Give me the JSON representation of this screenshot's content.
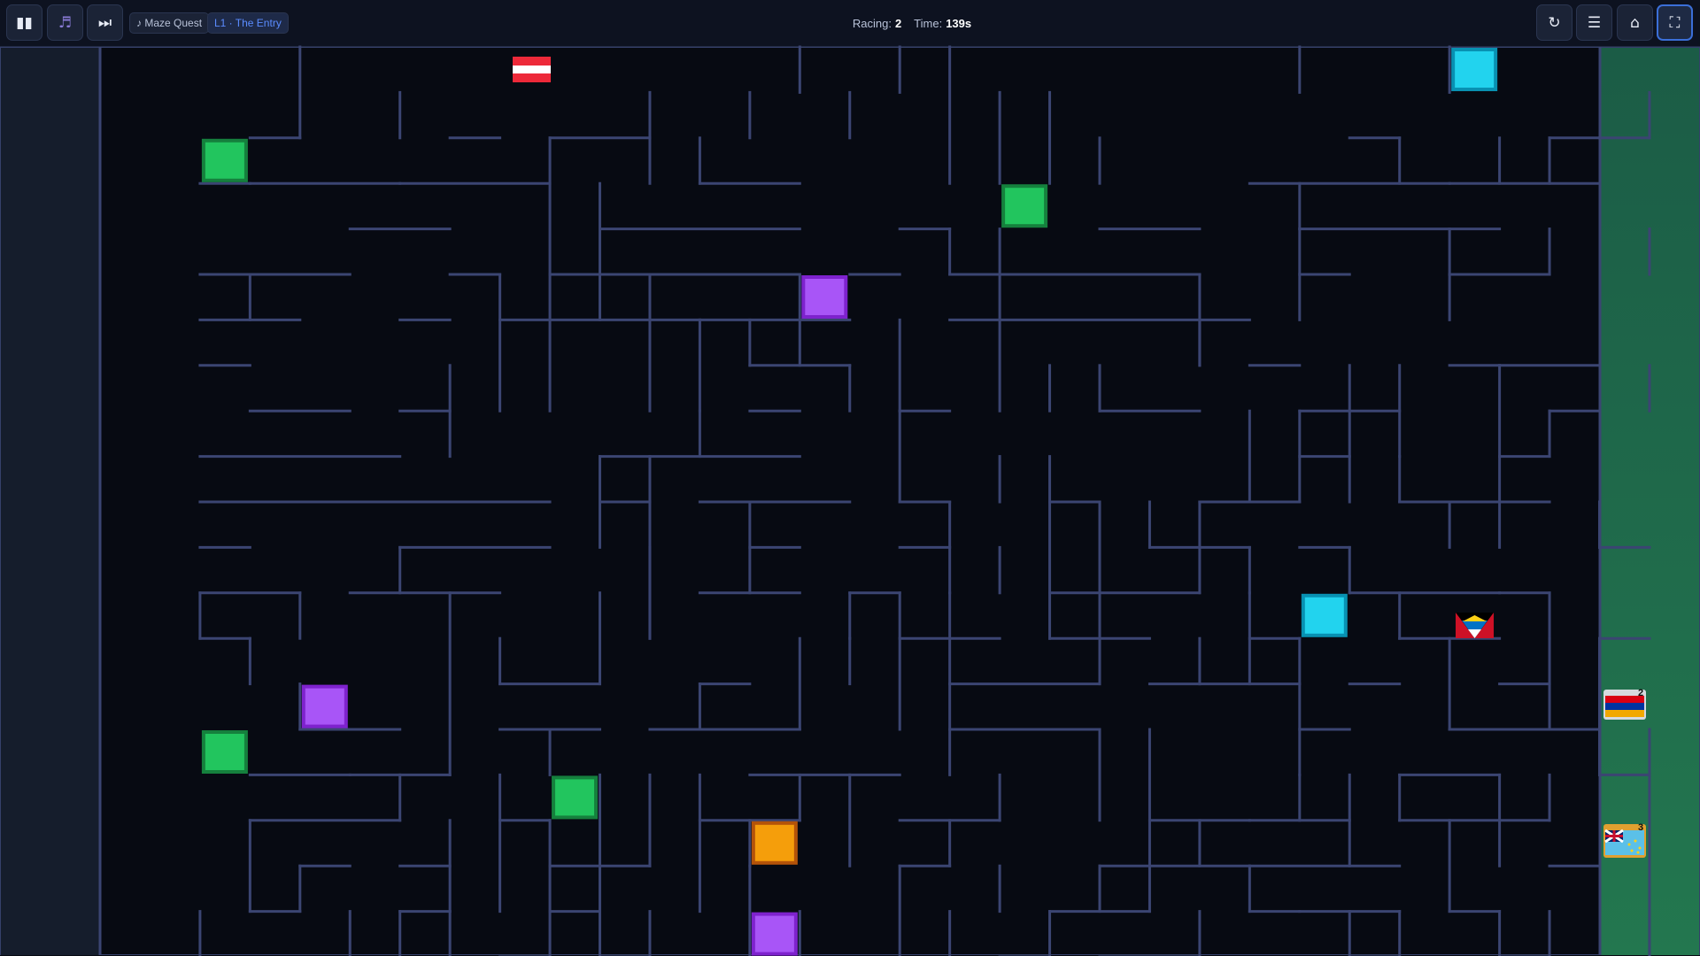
{
  "toolbar": {
    "pause_icon": "pause-icon",
    "music_icon": "music-note-icon",
    "skip_icon": "skip-forward-icon",
    "song_label": "♪ Maze Quest",
    "level_label": "L1 · The Entry",
    "restart_icon": "restart-icon",
    "menu_icon": "menu-icon",
    "home_icon": "home-icon",
    "fullscreen_icon": "fullscreen-icon"
  },
  "status": {
    "racing_label": "Racing:",
    "racing_value": "2",
    "time_label": "Time:",
    "time_value": "139s"
  },
  "finishers": [
    {
      "rank": "2",
      "flag": "armenia-flag"
    },
    {
      "rank": "3",
      "flag": "tuvalu-flag"
    }
  ],
  "racers": [
    {
      "name": "austria-flag"
    },
    {
      "name": "antigua-and-barbuda-flag"
    }
  ],
  "colors": {
    "wall": "#3b4572",
    "background": "#070a12",
    "start_zone": "#151d2c",
    "goal_zone": "#1f6b4c",
    "green_block": "#22c55e",
    "purple_block": "#a855f7",
    "cyan_block": "#22d3ee",
    "orange_block": "#f59e0b",
    "accent": "#3b6fd8"
  },
  "blocks": [
    {
      "color": "cyan",
      "cell": [
        27,
        0
      ]
    },
    {
      "color": "green",
      "cell": [
        2,
        2
      ]
    },
    {
      "color": "green",
      "cell": [
        18,
        3
      ]
    },
    {
      "color": "purple",
      "cell": [
        14,
        5
      ]
    },
    {
      "color": "cyan",
      "cell": [
        24,
        12
      ]
    },
    {
      "color": "purple",
      "cell": [
        4,
        14
      ]
    },
    {
      "color": "green",
      "cell": [
        2,
        15
      ]
    },
    {
      "color": "green",
      "cell": [
        9,
        16
      ]
    },
    {
      "color": "orange",
      "cell": [
        13,
        17
      ]
    },
    {
      "color": "purple",
      "cell": [
        13,
        19
      ]
    }
  ],
  "maze_walls": {
    "h": [
      [
        4,
        2,
        3
      ],
      [
        7,
        2,
        8
      ],
      [
        9,
        2,
        11
      ],
      [
        25,
        2,
        26
      ],
      [
        29,
        2,
        30
      ],
      [
        30,
        2,
        31
      ],
      [
        2,
        3,
        3
      ],
      [
        3,
        3,
        6
      ],
      [
        6,
        3,
        9
      ],
      [
        12,
        3,
        14
      ],
      [
        23,
        3,
        27
      ],
      [
        27,
        3,
        30
      ],
      [
        5,
        4,
        7
      ],
      [
        10,
        4,
        14
      ],
      [
        16,
        4,
        17
      ],
      [
        20,
        4,
        22
      ],
      [
        24,
        4,
        28
      ],
      [
        2,
        5,
        5
      ],
      [
        7,
        5,
        8
      ],
      [
        9,
        5,
        10
      ],
      [
        10,
        5,
        14
      ],
      [
        15,
        5,
        16
      ],
      [
        17,
        5,
        22
      ],
      [
        24,
        5,
        25
      ],
      [
        27,
        5,
        29
      ],
      [
        2,
        6,
        4
      ],
      [
        6,
        6,
        7
      ],
      [
        8,
        6,
        12
      ],
      [
        12,
        6,
        15
      ],
      [
        17,
        6,
        23
      ],
      [
        2,
        7,
        3
      ],
      [
        13,
        7,
        15
      ],
      [
        23,
        7,
        24
      ],
      [
        27,
        7,
        28
      ],
      [
        28,
        7,
        30
      ],
      [
        3,
        8,
        5
      ],
      [
        6,
        8,
        7
      ],
      [
        13,
        8,
        14
      ],
      [
        16,
        8,
        17
      ],
      [
        20,
        8,
        22
      ],
      [
        24,
        8,
        26
      ],
      [
        29,
        8,
        30
      ],
      [
        2,
        9,
        6
      ],
      [
        10,
        9,
        14
      ],
      [
        24,
        9,
        25
      ],
      [
        28,
        9,
        29
      ],
      [
        2,
        10,
        9
      ],
      [
        10,
        10,
        11
      ],
      [
        12,
        10,
        15
      ],
      [
        16,
        10,
        17
      ],
      [
        19,
        10,
        20
      ],
      [
        22,
        10,
        24
      ],
      [
        26,
        10,
        28
      ],
      [
        28,
        10,
        29
      ],
      [
        2,
        11,
        3
      ],
      [
        6,
        11,
        9
      ],
      [
        13,
        11,
        14
      ],
      [
        16,
        11,
        17
      ],
      [
        21,
        11,
        23
      ],
      [
        24,
        11,
        25
      ],
      [
        30,
        11,
        31
      ],
      [
        2,
        12,
        4
      ],
      [
        5,
        12,
        8
      ],
      [
        12,
        12,
        14
      ],
      [
        15,
        12,
        16
      ],
      [
        19,
        12,
        22
      ],
      [
        25,
        12,
        28
      ],
      [
        28,
        12,
        29
      ],
      [
        2,
        13,
        3
      ],
      [
        16,
        13,
        18
      ],
      [
        19,
        13,
        21
      ],
      [
        23,
        13,
        24
      ],
      [
        26,
        13,
        28
      ],
      [
        30,
        13,
        31
      ],
      [
        8,
        14,
        10
      ],
      [
        12,
        14,
        13
      ],
      [
        17,
        14,
        20
      ],
      [
        21,
        14,
        22
      ],
      [
        22,
        14,
        24
      ],
      [
        25,
        14,
        26
      ],
      [
        28,
        14,
        29
      ],
      [
        4,
        15,
        6
      ],
      [
        8,
        15,
        10
      ],
      [
        11,
        15,
        13
      ],
      [
        13,
        15,
        14
      ],
      [
        17,
        15,
        20
      ],
      [
        24,
        15,
        25
      ],
      [
        27,
        15,
        30
      ],
      [
        3,
        16,
        5
      ],
      [
        5,
        16,
        6
      ],
      [
        6,
        16,
        7
      ],
      [
        13,
        16,
        15
      ],
      [
        15,
        16,
        16
      ],
      [
        26,
        16,
        28
      ],
      [
        30,
        16,
        31
      ],
      [
        3,
        17,
        6
      ],
      [
        8,
        17,
        9
      ],
      [
        12,
        17,
        14
      ],
      [
        16,
        17,
        18
      ],
      [
        21,
        17,
        23
      ],
      [
        23,
        17,
        25
      ],
      [
        26,
        17,
        29
      ],
      [
        4,
        18,
        5
      ],
      [
        6,
        18,
        7
      ],
      [
        9,
        18,
        11
      ],
      [
        16,
        18,
        17
      ],
      [
        20,
        18,
        23
      ],
      [
        23,
        18,
        26
      ],
      [
        29,
        18,
        30
      ],
      [
        3,
        19,
        4
      ],
      [
        6,
        19,
        7
      ],
      [
        9,
        19,
        10
      ],
      [
        19,
        19,
        21
      ],
      [
        23,
        19,
        24
      ],
      [
        24,
        19,
        26
      ],
      [
        27,
        19,
        28
      ],
      [
        8,
        20,
        9
      ],
      [
        10,
        20,
        11
      ],
      [
        18,
        20,
        19
      ],
      [
        20,
        20,
        22
      ],
      [
        25,
        20,
        26
      ],
      [
        28,
        20,
        29
      ]
    ],
    "v": [
      [
        4,
        0,
        2
      ],
      [
        14,
        0,
        1
      ],
      [
        16,
        0,
        1
      ],
      [
        17,
        0,
        3
      ],
      [
        24,
        0,
        1
      ],
      [
        27,
        0,
        1
      ],
      [
        6,
        1,
        2
      ],
      [
        11,
        1,
        3
      ],
      [
        13,
        1,
        2
      ],
      [
        15,
        1,
        2
      ],
      [
        12,
        2,
        3
      ],
      [
        18,
        1,
        3
      ],
      [
        19,
        1,
        3
      ],
      [
        20,
        2,
        3
      ],
      [
        9,
        2,
        6
      ],
      [
        10,
        3,
        5
      ],
      [
        24,
        3,
        4
      ],
      [
        26,
        2,
        3
      ],
      [
        28,
        2,
        3
      ],
      [
        29,
        2,
        3
      ],
      [
        31,
        1,
        2
      ],
      [
        17,
        4,
        5
      ],
      [
        18,
        4,
        6
      ],
      [
        24,
        4,
        6
      ],
      [
        27,
        4,
        6
      ],
      [
        29,
        4,
        5
      ],
      [
        31,
        4,
        5
      ],
      [
        3,
        5,
        6
      ],
      [
        8,
        5,
        8
      ],
      [
        10,
        5,
        6
      ],
      [
        11,
        5,
        8
      ],
      [
        14,
        5,
        7
      ],
      [
        16,
        6,
        8
      ],
      [
        12,
        6,
        8
      ],
      [
        22,
        5,
        7
      ],
      [
        22,
        6,
        7
      ],
      [
        7,
        7,
        9
      ],
      [
        9,
        6,
        8
      ],
      [
        13,
        6,
        7
      ],
      [
        15,
        7,
        8
      ],
      [
        18,
        6,
        8
      ],
      [
        19,
        7,
        8
      ],
      [
        20,
        7,
        8
      ],
      [
        25,
        7,
        10
      ],
      [
        26,
        7,
        9
      ],
      [
        28,
        7,
        10
      ],
      [
        29,
        8,
        9
      ],
      [
        31,
        7,
        8
      ],
      [
        10,
        9,
        11
      ],
      [
        11,
        9,
        13
      ],
      [
        12,
        8,
        9
      ],
      [
        16,
        8,
        10
      ],
      [
        18,
        9,
        10
      ],
      [
        19,
        9,
        13
      ],
      [
        23,
        8,
        10
      ],
      [
        24,
        8,
        10
      ],
      [
        26,
        9,
        10
      ],
      [
        13,
        10,
        12
      ],
      [
        17,
        10,
        12
      ],
      [
        18,
        11,
        12
      ],
      [
        20,
        10,
        12
      ],
      [
        21,
        10,
        11
      ],
      [
        22,
        10,
        12
      ],
      [
        23,
        11,
        12
      ],
      [
        25,
        11,
        12
      ],
      [
        27,
        10,
        11
      ],
      [
        28,
        10,
        11
      ],
      [
        30,
        10,
        11
      ],
      [
        2,
        12,
        13
      ],
      [
        4,
        12,
        13
      ],
      [
        6,
        11,
        12
      ],
      [
        7,
        12,
        16
      ],
      [
        10,
        12,
        14
      ],
      [
        11,
        11,
        13
      ],
      [
        15,
        12,
        13
      ],
      [
        16,
        12,
        15
      ],
      [
        20,
        12,
        14
      ],
      [
        23,
        12,
        14
      ],
      [
        26,
        12,
        13
      ],
      [
        29,
        12,
        13
      ],
      [
        3,
        13,
        14
      ],
      [
        4,
        14,
        15
      ],
      [
        8,
        13,
        14
      ],
      [
        12,
        14,
        15
      ],
      [
        14,
        13,
        15
      ],
      [
        15,
        13,
        14
      ],
      [
        17,
        12,
        16
      ],
      [
        22,
        13,
        14
      ],
      [
        24,
        13,
        16
      ],
      [
        27,
        13,
        15
      ],
      [
        29,
        13,
        15
      ],
      [
        30,
        13,
        16
      ],
      [
        3,
        17,
        19
      ],
      [
        4,
        18,
        19
      ],
      [
        6,
        16,
        17
      ],
      [
        7,
        17,
        19
      ],
      [
        8,
        16,
        19
      ],
      [
        9,
        15,
        16
      ],
      [
        10,
        16,
        20
      ],
      [
        12,
        16,
        19
      ],
      [
        13,
        17,
        18
      ],
      [
        15,
        16,
        18
      ],
      [
        17,
        17,
        18
      ],
      [
        18,
        16,
        17
      ],
      [
        9,
        17,
        20
      ],
      [
        11,
        16,
        18
      ],
      [
        14,
        16,
        17
      ],
      [
        20,
        15,
        17
      ],
      [
        21,
        15,
        19
      ],
      [
        22,
        17,
        18
      ],
      [
        23,
        18,
        19
      ],
      [
        24,
        16,
        17
      ],
      [
        25,
        16,
        18
      ],
      [
        26,
        16,
        17
      ],
      [
        27,
        17,
        19
      ],
      [
        28,
        16,
        18
      ],
      [
        29,
        16,
        17
      ],
      [
        31,
        15,
        20
      ],
      [
        13,
        18,
        20
      ],
      [
        14,
        19,
        20
      ],
      [
        17,
        19,
        20
      ],
      [
        19,
        19,
        20
      ],
      [
        22,
        19,
        20
      ],
      [
        25,
        19,
        20
      ],
      [
        26,
        19,
        20
      ],
      [
        28,
        19,
        20
      ],
      [
        29,
        19,
        20
      ],
      [
        31,
        19,
        20
      ],
      [
        2,
        19,
        20
      ],
      [
        5,
        19,
        20
      ],
      [
        6,
        19,
        20
      ],
      [
        7,
        19,
        20
      ],
      [
        10,
        19,
        20
      ],
      [
        11,
        19,
        20
      ],
      [
        16,
        18,
        20
      ],
      [
        18,
        18,
        19
      ],
      [
        20,
        18,
        19
      ]
    ]
  }
}
